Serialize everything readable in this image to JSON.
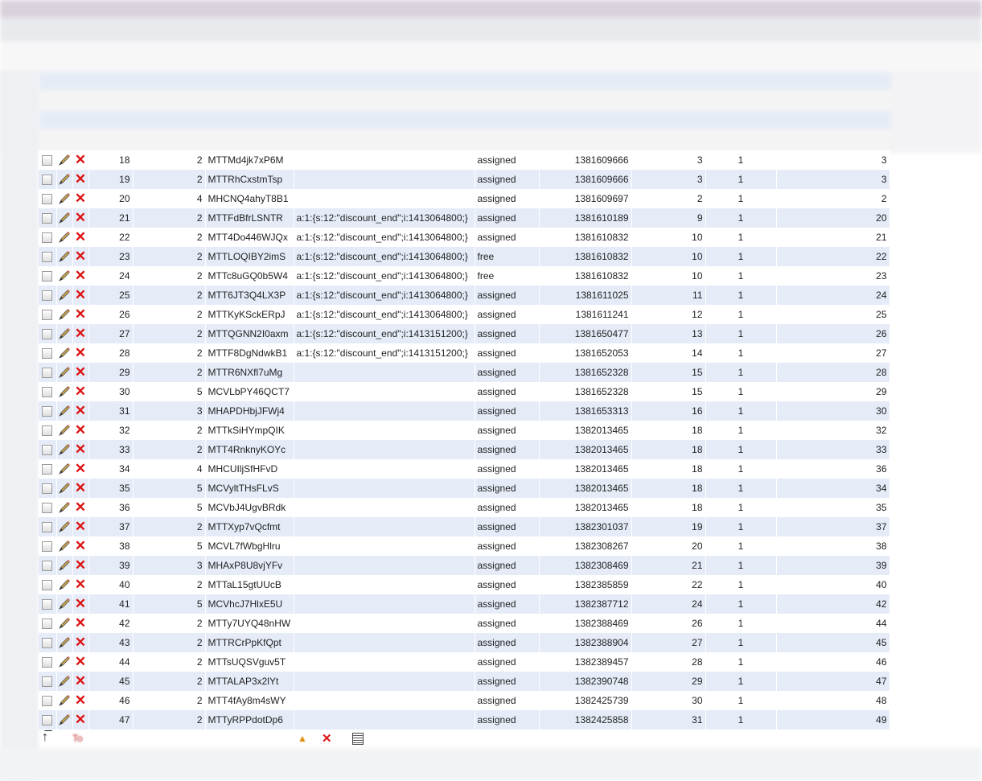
{
  "table": {
    "rows": [
      {
        "id": "18",
        "type": "2",
        "code": "MTTMd4jk7xP6M",
        "data": "",
        "status": "assigned",
        "time": "1381609666",
        "num": "3",
        "flag": "1",
        "ref": "3"
      },
      {
        "id": "19",
        "type": "2",
        "code": "MTTRhCxstmTsp",
        "data": "",
        "status": "assigned",
        "time": "1381609666",
        "num": "3",
        "flag": "1",
        "ref": "3"
      },
      {
        "id": "20",
        "type": "4",
        "code": "MHCNQ4ahyT8B1",
        "data": "",
        "status": "assigned",
        "time": "1381609697",
        "num": "2",
        "flag": "1",
        "ref": "2"
      },
      {
        "id": "21",
        "type": "2",
        "code": "MTTFdBfrLSNTR",
        "data": "a:1:{s:12:\"discount_end\";i:1413064800;}",
        "status": "assigned",
        "time": "1381610189",
        "num": "9",
        "flag": "1",
        "ref": "20"
      },
      {
        "id": "22",
        "type": "2",
        "code": "MTT4Do446WJQx",
        "data": "a:1:{s:12:\"discount_end\";i:1413064800;}",
        "status": "assigned",
        "time": "1381610832",
        "num": "10",
        "flag": "1",
        "ref": "21"
      },
      {
        "id": "23",
        "type": "2",
        "code": "MTTLOQIBY2imS",
        "data": "a:1:{s:12:\"discount_end\";i:1413064800;}",
        "status": "free",
        "time": "1381610832",
        "num": "10",
        "flag": "1",
        "ref": "22"
      },
      {
        "id": "24",
        "type": "2",
        "code": "MTTc8uGQ0b5W4",
        "data": "a:1:{s:12:\"discount_end\";i:1413064800;}",
        "status": "free",
        "time": "1381610832",
        "num": "10",
        "flag": "1",
        "ref": "23"
      },
      {
        "id": "25",
        "type": "2",
        "code": "MTT6JT3Q4LX3P",
        "data": "a:1:{s:12:\"discount_end\";i:1413064800;}",
        "status": "assigned",
        "time": "1381611025",
        "num": "11",
        "flag": "1",
        "ref": "24"
      },
      {
        "id": "26",
        "type": "2",
        "code": "MTTKyKSckERpJ",
        "data": "a:1:{s:12:\"discount_end\";i:1413064800;}",
        "status": "assigned",
        "time": "1381611241",
        "num": "12",
        "flag": "1",
        "ref": "25"
      },
      {
        "id": "27",
        "type": "2",
        "code": "MTTQGNN2I0axm",
        "data": "a:1:{s:12:\"discount_end\";i:1413151200;}",
        "status": "assigned",
        "time": "1381650477",
        "num": "13",
        "flag": "1",
        "ref": "26"
      },
      {
        "id": "28",
        "type": "2",
        "code": "MTTF8DgNdwkB1",
        "data": "a:1:{s:12:\"discount_end\";i:1413151200;}",
        "status": "assigned",
        "time": "1381652053",
        "num": "14",
        "flag": "1",
        "ref": "27"
      },
      {
        "id": "29",
        "type": "2",
        "code": "MTTR6NXfl7uMg",
        "data": "",
        "status": "assigned",
        "time": "1381652328",
        "num": "15",
        "flag": "1",
        "ref": "28"
      },
      {
        "id": "30",
        "type": "5",
        "code": "MCVLbPY46QCT7",
        "data": "",
        "status": "assigned",
        "time": "1381652328",
        "num": "15",
        "flag": "1",
        "ref": "29"
      },
      {
        "id": "31",
        "type": "3",
        "code": "MHAPDHbjJFWj4",
        "data": "",
        "status": "assigned",
        "time": "1381653313",
        "num": "16",
        "flag": "1",
        "ref": "30"
      },
      {
        "id": "32",
        "type": "2",
        "code": "MTTkSiHYmpQIK",
        "data": "",
        "status": "assigned",
        "time": "1382013465",
        "num": "18",
        "flag": "1",
        "ref": "32"
      },
      {
        "id": "33",
        "type": "2",
        "code": "MTT4RnknyKOYc",
        "data": "",
        "status": "assigned",
        "time": "1382013465",
        "num": "18",
        "flag": "1",
        "ref": "33"
      },
      {
        "id": "34",
        "type": "4",
        "code": "MHCUIljSfHFvD",
        "data": "",
        "status": "assigned",
        "time": "1382013465",
        "num": "18",
        "flag": "1",
        "ref": "36"
      },
      {
        "id": "35",
        "type": "5",
        "code": "MCVyltTHsFLvS",
        "data": "",
        "status": "assigned",
        "time": "1382013465",
        "num": "18",
        "flag": "1",
        "ref": "34"
      },
      {
        "id": "36",
        "type": "5",
        "code": "MCVbJ4UgvBRdk",
        "data": "",
        "status": "assigned",
        "time": "1382013465",
        "num": "18",
        "flag": "1",
        "ref": "35"
      },
      {
        "id": "37",
        "type": "2",
        "code": "MTTXyp7vQcfmt",
        "data": "",
        "status": "assigned",
        "time": "1382301037",
        "num": "19",
        "flag": "1",
        "ref": "37"
      },
      {
        "id": "38",
        "type": "5",
        "code": "MCVL7fWbgHlru",
        "data": "",
        "status": "assigned",
        "time": "1382308267",
        "num": "20",
        "flag": "1",
        "ref": "38"
      },
      {
        "id": "39",
        "type": "3",
        "code": "MHAxP8U8vjYFv",
        "data": "",
        "status": "assigned",
        "time": "1382308469",
        "num": "21",
        "flag": "1",
        "ref": "39"
      },
      {
        "id": "40",
        "type": "2",
        "code": "MTTaL15gtUUcB",
        "data": "",
        "status": "assigned",
        "time": "1382385859",
        "num": "22",
        "flag": "1",
        "ref": "40"
      },
      {
        "id": "41",
        "type": "5",
        "code": "MCVhcJ7HlxE5U",
        "data": "",
        "status": "assigned",
        "time": "1382387712",
        "num": "24",
        "flag": "1",
        "ref": "42"
      },
      {
        "id": "42",
        "type": "2",
        "code": "MTTy7UYQ48nHW",
        "data": "",
        "status": "assigned",
        "time": "1382388469",
        "num": "26",
        "flag": "1",
        "ref": "44"
      },
      {
        "id": "43",
        "type": "2",
        "code": "MTTRCrPpKfQpt",
        "data": "",
        "status": "assigned",
        "time": "1382388904",
        "num": "27",
        "flag": "1",
        "ref": "45"
      },
      {
        "id": "44",
        "type": "2",
        "code": "MTTsUQSVguv5T",
        "data": "",
        "status": "assigned",
        "time": "1382389457",
        "num": "28",
        "flag": "1",
        "ref": "46"
      },
      {
        "id": "45",
        "type": "2",
        "code": "MTTALAP3x2lYt",
        "data": "",
        "status": "assigned",
        "time": "1382390748",
        "num": "29",
        "flag": "1",
        "ref": "47"
      },
      {
        "id": "46",
        "type": "2",
        "code": "MTT4fAy8m4sWY",
        "data": "",
        "status": "assigned",
        "time": "1382425739",
        "num": "30",
        "flag": "1",
        "ref": "48"
      },
      {
        "id": "47",
        "type": "2",
        "code": "MTTyRPPdotDp6",
        "data": "",
        "status": "assigned",
        "time": "1382425858",
        "num": "31",
        "flag": "1",
        "ref": "49"
      }
    ]
  },
  "footer": {
    "label": "To"
  },
  "colors": {
    "row_alt": "#e5ecf8",
    "delete": "#dd1111",
    "footer_link": "#bb2222"
  }
}
